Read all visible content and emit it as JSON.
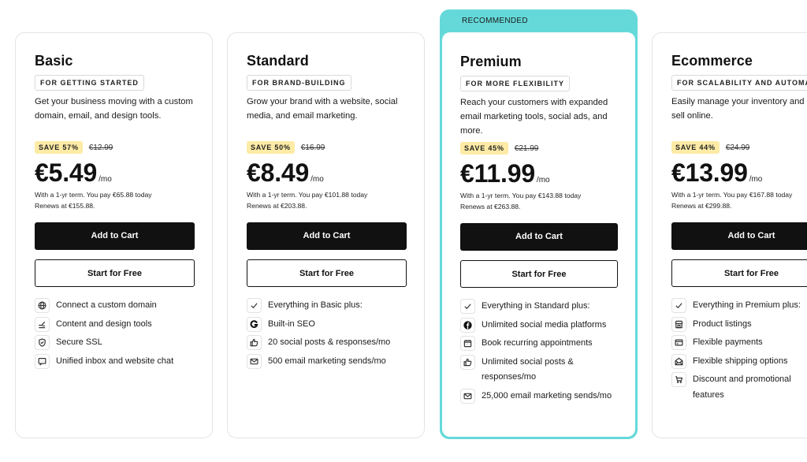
{
  "recommended_label": "RECOMMENDED",
  "accent_color": "#65d9d9",
  "save_badge_color": "#fdeba6",
  "plans": [
    {
      "name": "Basic",
      "tag": "FOR GETTING STARTED",
      "description": "Get your business moving with a custom domain, email, and design tools.",
      "save": "SAVE 57%",
      "old_price": "€12.99",
      "price": "€5.49",
      "per": "/mo",
      "term_line1": "With a 1-yr term. You pay €65.88 today",
      "term_line2": "Renews at €155.88.",
      "add_to_cart": "Add to Cart",
      "start_free": "Start for Free",
      "features": [
        {
          "icon": "globe-icon",
          "text": "Connect a custom domain"
        },
        {
          "icon": "pen-icon",
          "text": "Content and design tools"
        },
        {
          "icon": "shield-icon",
          "text": "Secure SSL"
        },
        {
          "icon": "chat-icon",
          "text": "Unified inbox and website chat"
        }
      ]
    },
    {
      "name": "Standard",
      "tag": "FOR BRAND-BUILDING",
      "description": "Grow your brand with a website, social media, and email marketing.",
      "save": "SAVE 50%",
      "old_price": "€16.99",
      "price": "€8.49",
      "per": "/mo",
      "term_line1": "With a 1-yr term. You pay €101.88 today",
      "term_line2": "Renews at €203.88.",
      "add_to_cart": "Add to Cart",
      "start_free": "Start for Free",
      "features": [
        {
          "icon": "check-icon",
          "text": "Everything in Basic plus:"
        },
        {
          "icon": "google-icon",
          "text": "Built-in SEO"
        },
        {
          "icon": "thumbs-up-icon",
          "text": "20 social posts & responses/mo"
        },
        {
          "icon": "mail-icon",
          "text": "500 email marketing sends/mo"
        }
      ]
    },
    {
      "name": "Premium",
      "tag": "FOR MORE FLEXIBILITY",
      "description": "Reach your customers with expanded email marketing tools, social ads, and more.",
      "save": "SAVE 45%",
      "old_price": "€21.99",
      "price": "€11.99",
      "per": "/mo",
      "term_line1": "With a 1-yr term. You pay €143.88 today",
      "term_line2": "Renews at €263.88.",
      "add_to_cart": "Add to Cart",
      "start_free": "Start for Free",
      "features": [
        {
          "icon": "check-icon",
          "text": "Everything in Standard plus:"
        },
        {
          "icon": "facebook-icon",
          "text": "Unlimited social media platforms"
        },
        {
          "icon": "calendar-icon",
          "text": "Book recurring appointments"
        },
        {
          "icon": "thumbs-up-icon",
          "text": "Unlimited social posts & responses/mo"
        },
        {
          "icon": "mail-icon",
          "text": "25,000 email marketing sends/mo"
        }
      ]
    },
    {
      "name": "Ecommerce",
      "tag": "FOR SCALABILITY AND AUTOMATION",
      "description": "Easily manage your inventory and sell online.",
      "save": "SAVE 44%",
      "old_price": "€24.99",
      "price": "€13.99",
      "per": "/mo",
      "term_line1": "With a 1-yr term. You pay €167.88 today",
      "term_line2": "Renews at €299.88.",
      "add_to_cart": "Add to Cart",
      "start_free": "Start for Free",
      "features": [
        {
          "icon": "check-icon",
          "text": "Everything in Premium plus:"
        },
        {
          "icon": "storefront-icon",
          "text": "Product listings"
        },
        {
          "icon": "credit-card-icon",
          "text": "Flexible payments"
        },
        {
          "icon": "open-envelope-icon",
          "text": "Flexible shipping options"
        },
        {
          "icon": "cart-icon",
          "text": "Discount and promotional features"
        }
      ]
    }
  ]
}
